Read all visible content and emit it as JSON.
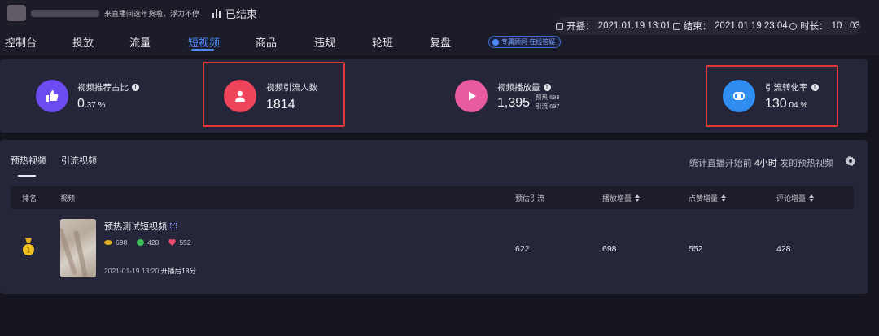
{
  "header": {
    "room_title": "来直播间选年货啦，浮力不停",
    "status": "已结束",
    "start_label": "开播：",
    "start_time": "2021.01.19 13:01",
    "end_label": "结束：",
    "end_time": "2021.01.19 23:04",
    "duration_label": "时长：",
    "duration": "10 : 03"
  },
  "nav": {
    "items": [
      "控制台",
      "投放",
      "流量",
      "短视频",
      "商品",
      "违规",
      "轮班",
      "复盘"
    ],
    "active": "短视频",
    "consult_label": "专属顾问 在线答疑"
  },
  "metrics": [
    {
      "title": "视频推荐占比",
      "value": "0",
      "value_small": ".37 %",
      "icon": "thumbs-up-icon",
      "color": "#6c4cf0"
    },
    {
      "title": "视频引流人数",
      "value": "1814",
      "value_small": "",
      "icon": "user-icon",
      "color": "#f0445c"
    },
    {
      "title": "视频播放量",
      "value": "1,395",
      "value_small": "",
      "sub1": "预热 698",
      "sub2": "引流 697",
      "icon": "play-icon",
      "color": "#e85ba0"
    },
    {
      "title": "引流转化率",
      "value": "130",
      "value_small": ".04 %",
      "icon": "conversion-icon",
      "color": "#2f8cf0"
    }
  ],
  "videos": {
    "tabs": [
      "预热视频",
      "引流视频"
    ],
    "stat_prefix": "统计直播开始前",
    "stat_value": "4小时",
    "stat_suffix": "发的预热视频",
    "columns": [
      "排名",
      "视频",
      "预估引流",
      "播放增量",
      "点赞增量",
      "评论增量"
    ],
    "rows": [
      {
        "rank": "1",
        "title": "预热测试短视频",
        "views": "698",
        "comments": "428",
        "likes": "552",
        "publish_time": "2021-01-19 13:20",
        "publish_note": "开播后18分",
        "est_traffic": "622",
        "play_inc": "698",
        "like_inc": "552",
        "comment_inc": "428"
      }
    ]
  }
}
